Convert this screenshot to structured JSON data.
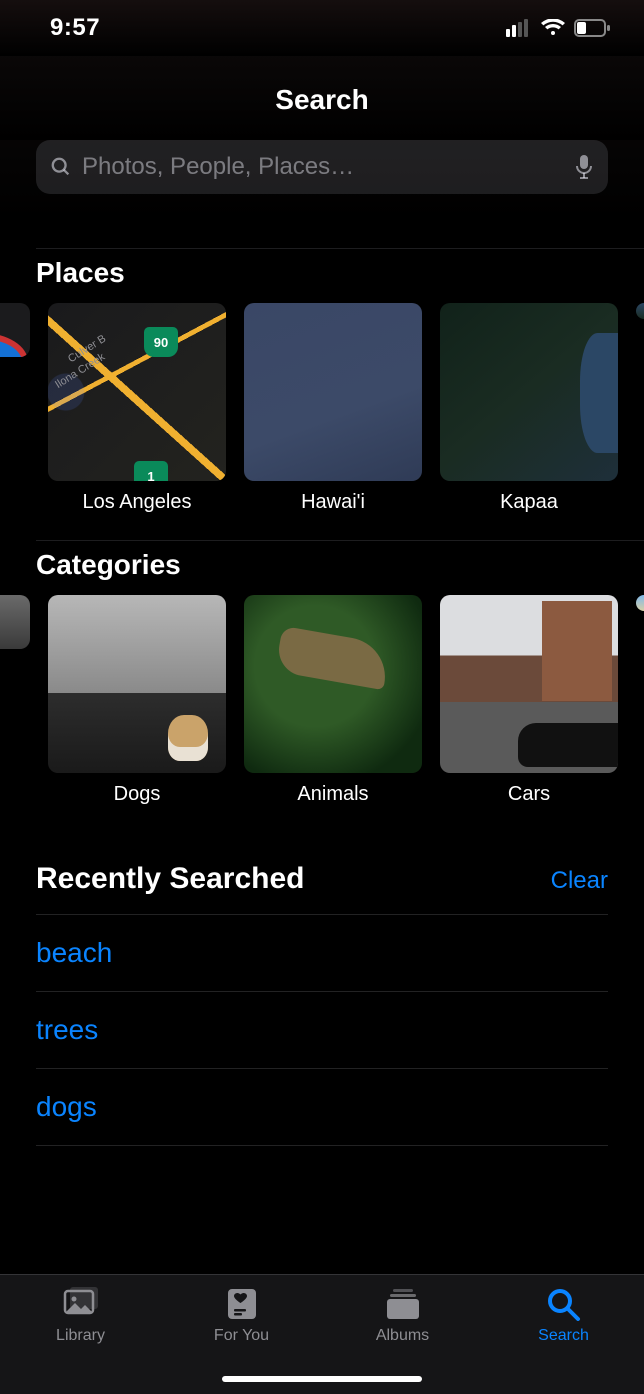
{
  "status": {
    "time": "9:57"
  },
  "header": {
    "title": "Search"
  },
  "search": {
    "placeholder": "Photos, People, Places…",
    "value": ""
  },
  "places": {
    "title": "Places",
    "items": [
      {
        "label": "Los Angeles",
        "shield": "90",
        "creek_label": "Ilona Creek",
        "culver_label": "Culver B"
      },
      {
        "label": "Hawai'i"
      },
      {
        "label": "Kapaa"
      }
    ]
  },
  "categories": {
    "title": "Categories",
    "items": [
      {
        "label": "Dogs"
      },
      {
        "label": "Animals"
      },
      {
        "label": "Cars"
      }
    ]
  },
  "recent": {
    "title": "Recently Searched",
    "clear": "Clear",
    "items": [
      "beach",
      "trees",
      "dogs"
    ]
  },
  "tabs": {
    "library": "Library",
    "for_you": "For You",
    "albums": "Albums",
    "search": "Search"
  }
}
